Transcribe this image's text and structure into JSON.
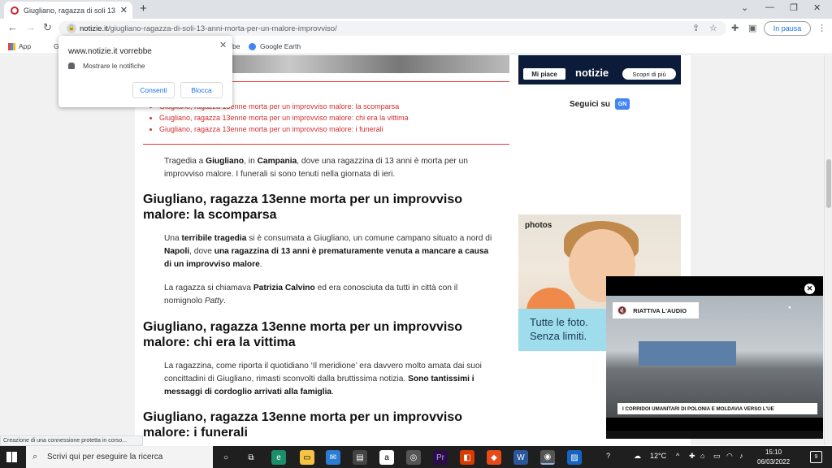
{
  "browser": {
    "tab_title": "Giugliano, ragazza di soli 13 anni",
    "url_domain": "notizie.it",
    "url_path": "/giugliano-ragazza-di-soli-13-anni-morta-per-un-malore-improvviso/",
    "pause_label": "In pausa",
    "bookmarks": [
      "App",
      "G",
      "be",
      "Google Earth"
    ]
  },
  "popup": {
    "title": "www.notizie.it vorrebbe",
    "line": "Mostrare le notifiche",
    "allow": "Consenti",
    "block": "Blocca"
  },
  "article": {
    "toc": [
      "Giugliano, ragazza 13enne morta per un improvviso malore: la scomparsa",
      "Giugliano, ragazza 13enne morta per un improvviso malore: chi era la vittima",
      "Giugliano, ragazza 13enne morta per un improvviso malore: i funerali"
    ],
    "intro": {
      "a": "Tragedia a ",
      "b": "Giugliano",
      "c": ", in ",
      "d": "Campania",
      "e": ", dove una ragazzina di 13 anni è morta per un improvviso malore. I funerali si sono tenuti nella giornata di ieri."
    },
    "h1": "Giugliano, ragazza 13enne morta per un improvviso malore: la scomparsa",
    "p1": {
      "a": "Una ",
      "b": "terribile tragedia",
      "c": " si è consumata a Giugliano, un comune campano situato a nord di ",
      "d": "Napoli",
      "e": ", dove ",
      "f": "una ragazzina di 13 anni è prematuramente venuta a mancare a causa di un improvviso malore",
      "g": "."
    },
    "p2": {
      "a": "La ragazza si chiamava ",
      "b": "Patrizia Calvino",
      "c": " ed era conosciuta da tutti in città con il nomignolo ",
      "d": "Patty",
      "e": "."
    },
    "h2": "Giugliano, ragazza 13enne morta per un improvviso malore: chi era la vittima",
    "p3": {
      "a": "La ragazzina, come riporta il quotidiano ‘Il meridione’ era davvero molto amata dai suoi concittadini di Giugliano, rimasti sconvolti dalla bruttissima notizia. ",
      "b": "Sono tantissimi i messaggi di cordoglio arrivati alla famiglia",
      "c": "."
    },
    "h3": "Giugliano, ragazza 13enne morta per un improvviso malore: i funerali"
  },
  "sidebar": {
    "like": "Mi piace",
    "logo": "notizie",
    "discover": "Scopri di più",
    "follow": "Seguici su",
    "follow_badge": "GN",
    "ad_brand": "photos",
    "ad_text_1": "Tutte le foto.",
    "ad_text_2": "Senza limiti."
  },
  "video": {
    "unmute": "RIATTIVA L'AUDIO",
    "caption": "I CORRIDOI UMANITARI DI POLONIA E MOLDAVIA VERSO L'UE"
  },
  "status_text": "Creazione di una connessione protetta in corso...",
  "taskbar": {
    "search": "Scrivi qui per eseguire la ricerca",
    "temp": "12°C",
    "time": "15:10",
    "date": "06/03/2022",
    "notif_count": "9"
  },
  "colors": {
    "accent": "#d32f2f",
    "link": "#1a73e8",
    "taskbar": "#1f1f1f"
  }
}
